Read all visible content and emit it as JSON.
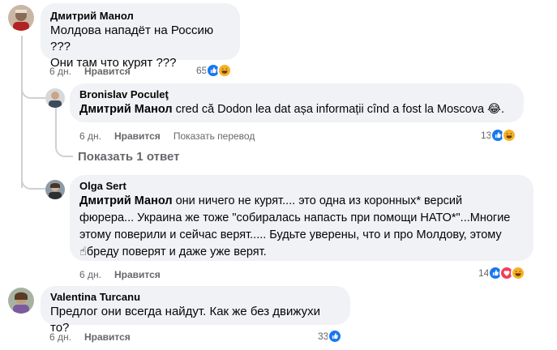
{
  "comments": [
    {
      "author": "Дмитрий Манол",
      "lines": [
        "Молдова нападёт на Россию ???",
        "Они там что курят ???"
      ],
      "time": "6 дн.",
      "like_label": "Нравится",
      "reaction_count": "65",
      "reactions": [
        "like",
        "haha"
      ]
    },
    {
      "author": "Bronislav Poculeţ",
      "mention": "Дмитрий Манол",
      "text": " cred că Dodon lea dat așa informații cînd a fost la Moscova 😂.",
      "time": "6 дн.",
      "like_label": "Нравится",
      "translate_label": "Показать перевод",
      "reaction_count": "13",
      "reactions": [
        "like",
        "haha"
      ],
      "show_replies": "Показать 1 ответ"
    },
    {
      "author": "Olga Sert",
      "mention": "Дмитрий Манол",
      "lines": [
        " они ничего не курят.... это одна из коронных* версий",
        "фюрера... Украина же тоже \"собиралась напасть при помощи НАТО*\"...Многие",
        "этому поверили и сейчас верят..... Будьте уверены, что и про Молдову, этому",
        "☝бреду поверят и даже уже верят."
      ],
      "time": "6 дн.",
      "like_label": "Нравится",
      "reaction_count": "14",
      "reactions": [
        "like",
        "love",
        "haha"
      ]
    },
    {
      "author": "Valentina Turcanu",
      "lines": [
        "Предлог они всегда найдут. Как же без движухи то?"
      ],
      "time": "6 дн.",
      "like_label": "Нравится",
      "reaction_count": "33",
      "reactions": [
        "like"
      ]
    }
  ],
  "colors": {
    "bubble": "#f0f2f5",
    "meta": "#65676b",
    "like_blue": "#1877f2",
    "love_red": "#f33e58",
    "haha_yellow": "#f7b125",
    "thread_line": "#ced0d4"
  }
}
